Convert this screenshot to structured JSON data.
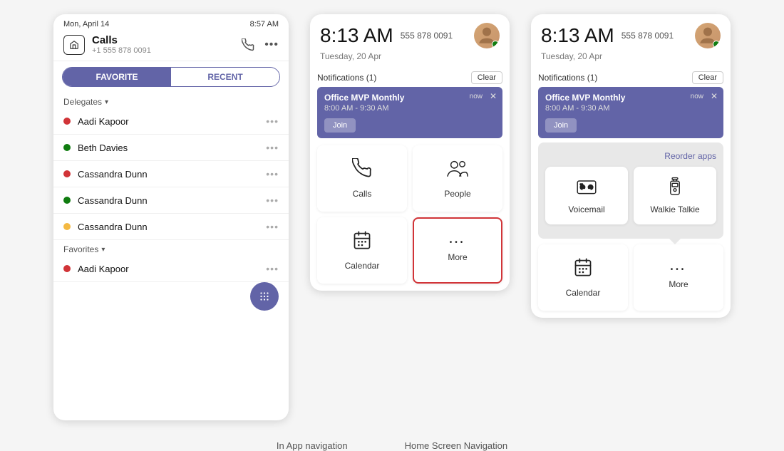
{
  "left_phone": {
    "status_bar": {
      "date": "Mon, April 14",
      "time": "8:57 AM"
    },
    "header": {
      "title": "Calls",
      "subtitle": "+1 555 878 0091"
    },
    "tabs": {
      "active": "FAVORITE",
      "inactive": "RECENT"
    },
    "delegates_label": "Delegates",
    "contacts": [
      {
        "name": "Aadi Kapoor",
        "status": "red"
      },
      {
        "name": "Beth Davies",
        "status": "green"
      },
      {
        "name": "Cassandra Dunn",
        "status": "red"
      },
      {
        "name": "Cassandra Dunn",
        "status": "green"
      },
      {
        "name": "Cassandra Dunn",
        "status": "orange"
      }
    ],
    "favorites_label": "Favorites",
    "favorites": [
      {
        "name": "Aadi Kapoor",
        "status": "red"
      }
    ]
  },
  "mid_phone": {
    "time": "8:13 AM",
    "phone_number": "555 878 0091",
    "date": "Tuesday, 20 Apr",
    "notifications_label": "Notifications (1)",
    "clear_label": "Clear",
    "notification": {
      "title": "Office MVP Monthly",
      "time_tag": "now",
      "time_range": "8:00 AM - 9:30 AM",
      "join_label": "Join"
    },
    "apps": [
      {
        "icon": "📞",
        "label": "Calls",
        "icon_type": "calls"
      },
      {
        "icon": "👥",
        "label": "People",
        "icon_type": "people"
      },
      {
        "icon": "📅",
        "label": "Calendar",
        "icon_type": "calendar"
      },
      {
        "icon": "...",
        "label": "More",
        "icon_type": "more",
        "highlighted": true
      }
    ]
  },
  "right_phone": {
    "time": "8:13 AM",
    "phone_number": "555 878 0091",
    "date": "Tuesday, 20 Apr",
    "notifications_label": "Notifications (1)",
    "clear_label": "Clear",
    "notification": {
      "title": "Office MVP Monthly",
      "time_tag": "now",
      "time_range": "8:00 AM - 9:30 AM",
      "join_label": "Join"
    },
    "reorder_label": "Reorder apps",
    "popup_apps": [
      {
        "icon": "vm",
        "label": "Voicemail",
        "icon_type": "voicemail"
      },
      {
        "icon": "wt",
        "label": "Walkie Talkie",
        "icon_type": "walkie-talkie"
      }
    ],
    "bottom_apps": [
      {
        "icon": "📅",
        "label": "Calendar",
        "icon_type": "calendar"
      },
      {
        "icon": "...",
        "label": "More",
        "icon_type": "more"
      }
    ]
  },
  "captions": {
    "left": "In App navigation",
    "right": "Home Screen Navigation"
  }
}
